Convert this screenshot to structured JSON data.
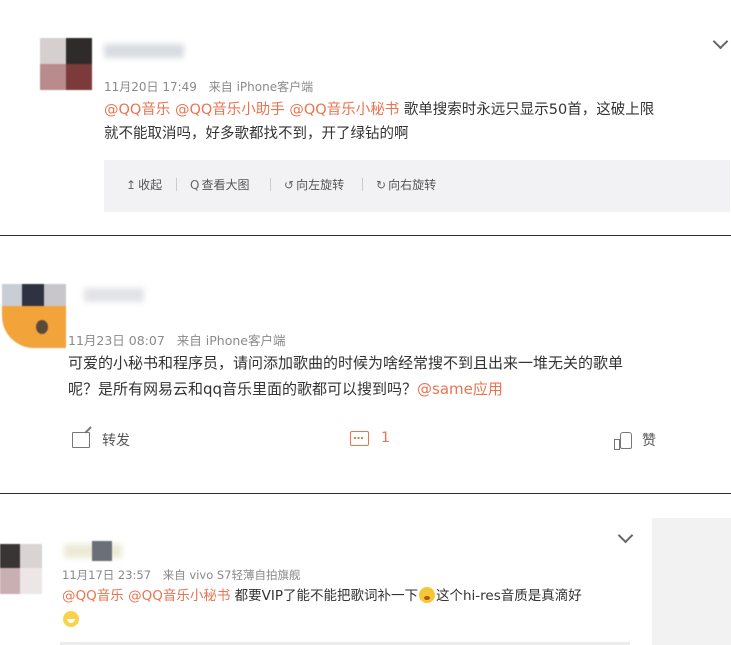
{
  "posts": [
    {
      "date": "11月20日 17:49",
      "source": "来自 iPhone客户端",
      "content": {
        "mentions": [
          "@QQ音乐",
          "@QQ音乐小助手",
          "@QQ音乐小秘书"
        ],
        "line1_text": "歌单搜索时永远只显示50首，这破上限",
        "line2_text": "就不能取消吗，好多歌都找不到，开了绿钻的啊"
      },
      "toolbar": [
        {
          "icon": "collapse-up-icon",
          "glyph": "↥",
          "label": "收起"
        },
        {
          "icon": "magnifier-icon",
          "glyph": "Q",
          "label": "查看大图"
        },
        {
          "icon": "rotate-left-icon",
          "glyph": "↺",
          "label": "向左旋转"
        },
        {
          "icon": "rotate-right-icon",
          "glyph": "↻",
          "label": "向右旋转"
        }
      ]
    },
    {
      "date": "11月23日 08:07",
      "source": "来自 iPhone客户端",
      "content": {
        "line1_text": "可爱的小秘书和程序员，请问添加歌曲的时候为啥经常搜不到且出来一堆无关的歌单",
        "line2_text": "呢？是所有网易云和qq音乐里面的歌都可以搜到吗？",
        "mention": "@same应用"
      },
      "actions": {
        "share_label": "转发",
        "comment_count": "1",
        "like_label": "赞"
      }
    },
    {
      "date": "11月17日 23:57",
      "source": "来自 vivo S7轻薄自拍旗舰",
      "content": {
        "mentions": [
          "@QQ音乐",
          "@QQ音乐小秘书"
        ],
        "text_a": "都要VIP了能不能把歌词补一下",
        "text_b": "这个hi-res音质是真滴好"
      }
    }
  ],
  "colors": {
    "mention": "#eb7350",
    "meta": "#8a8a8a",
    "toolbar_bg": "#f2f2f5"
  }
}
